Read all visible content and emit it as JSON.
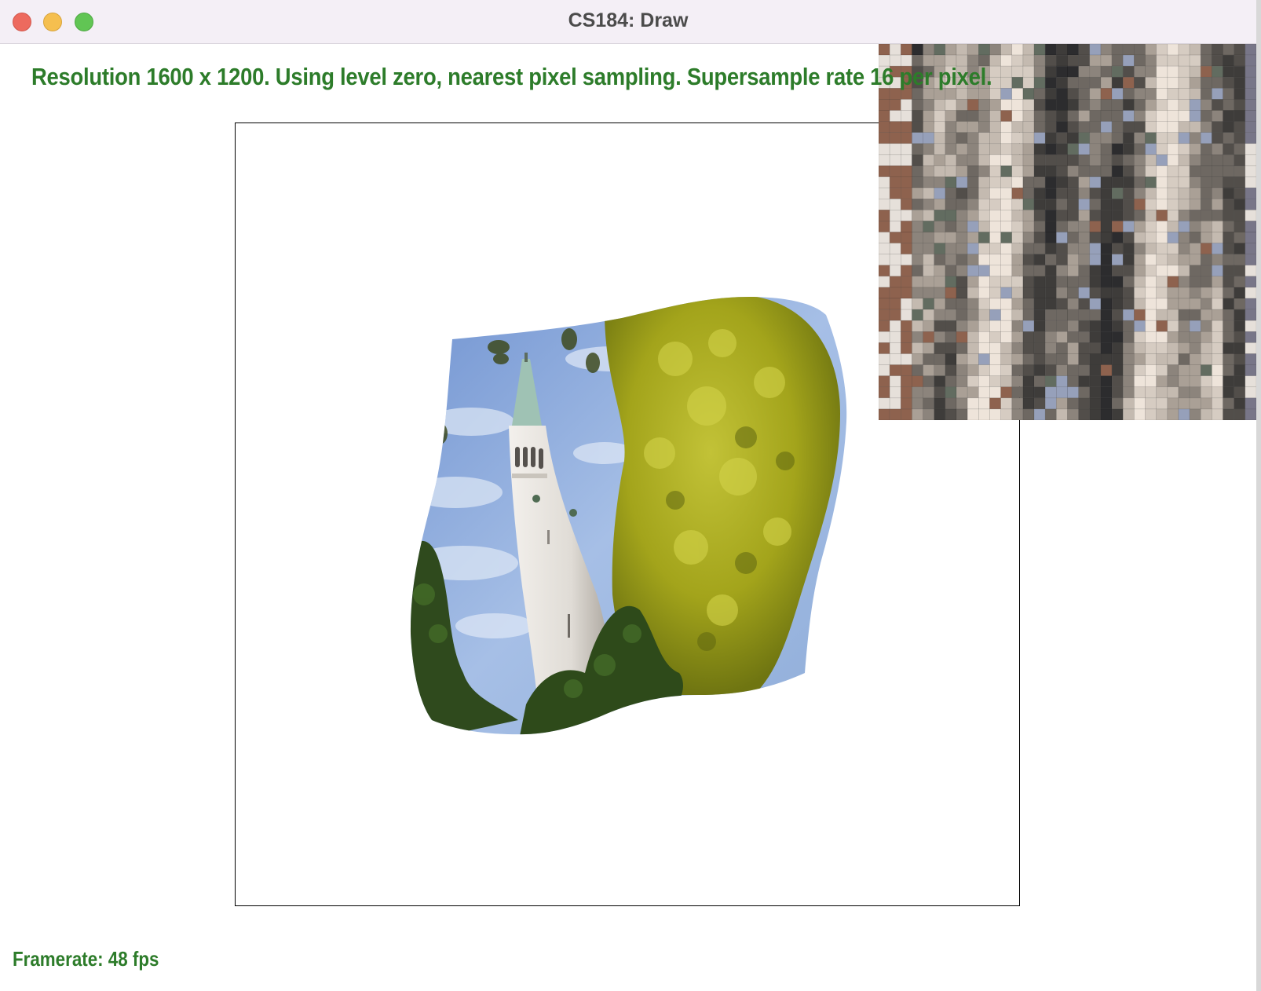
{
  "window": {
    "title": "CS184: Draw"
  },
  "overlay": {
    "status_text": "Resolution 1600 x 1200. Using level zero, nearest pixel sampling. Supersample rate 16 per pixel.",
    "framerate_text": "Framerate: 48 fps"
  },
  "colors": {
    "overlay_text": "#2d7c2a",
    "sky": "#8fb0df",
    "tower": "#e4e0da",
    "foliage": "#9ea318",
    "dark_trees": "#2f4a1d"
  },
  "icons": {
    "close": "traffic-close",
    "minimize": "traffic-minimize",
    "maximize": "traffic-maximize"
  }
}
